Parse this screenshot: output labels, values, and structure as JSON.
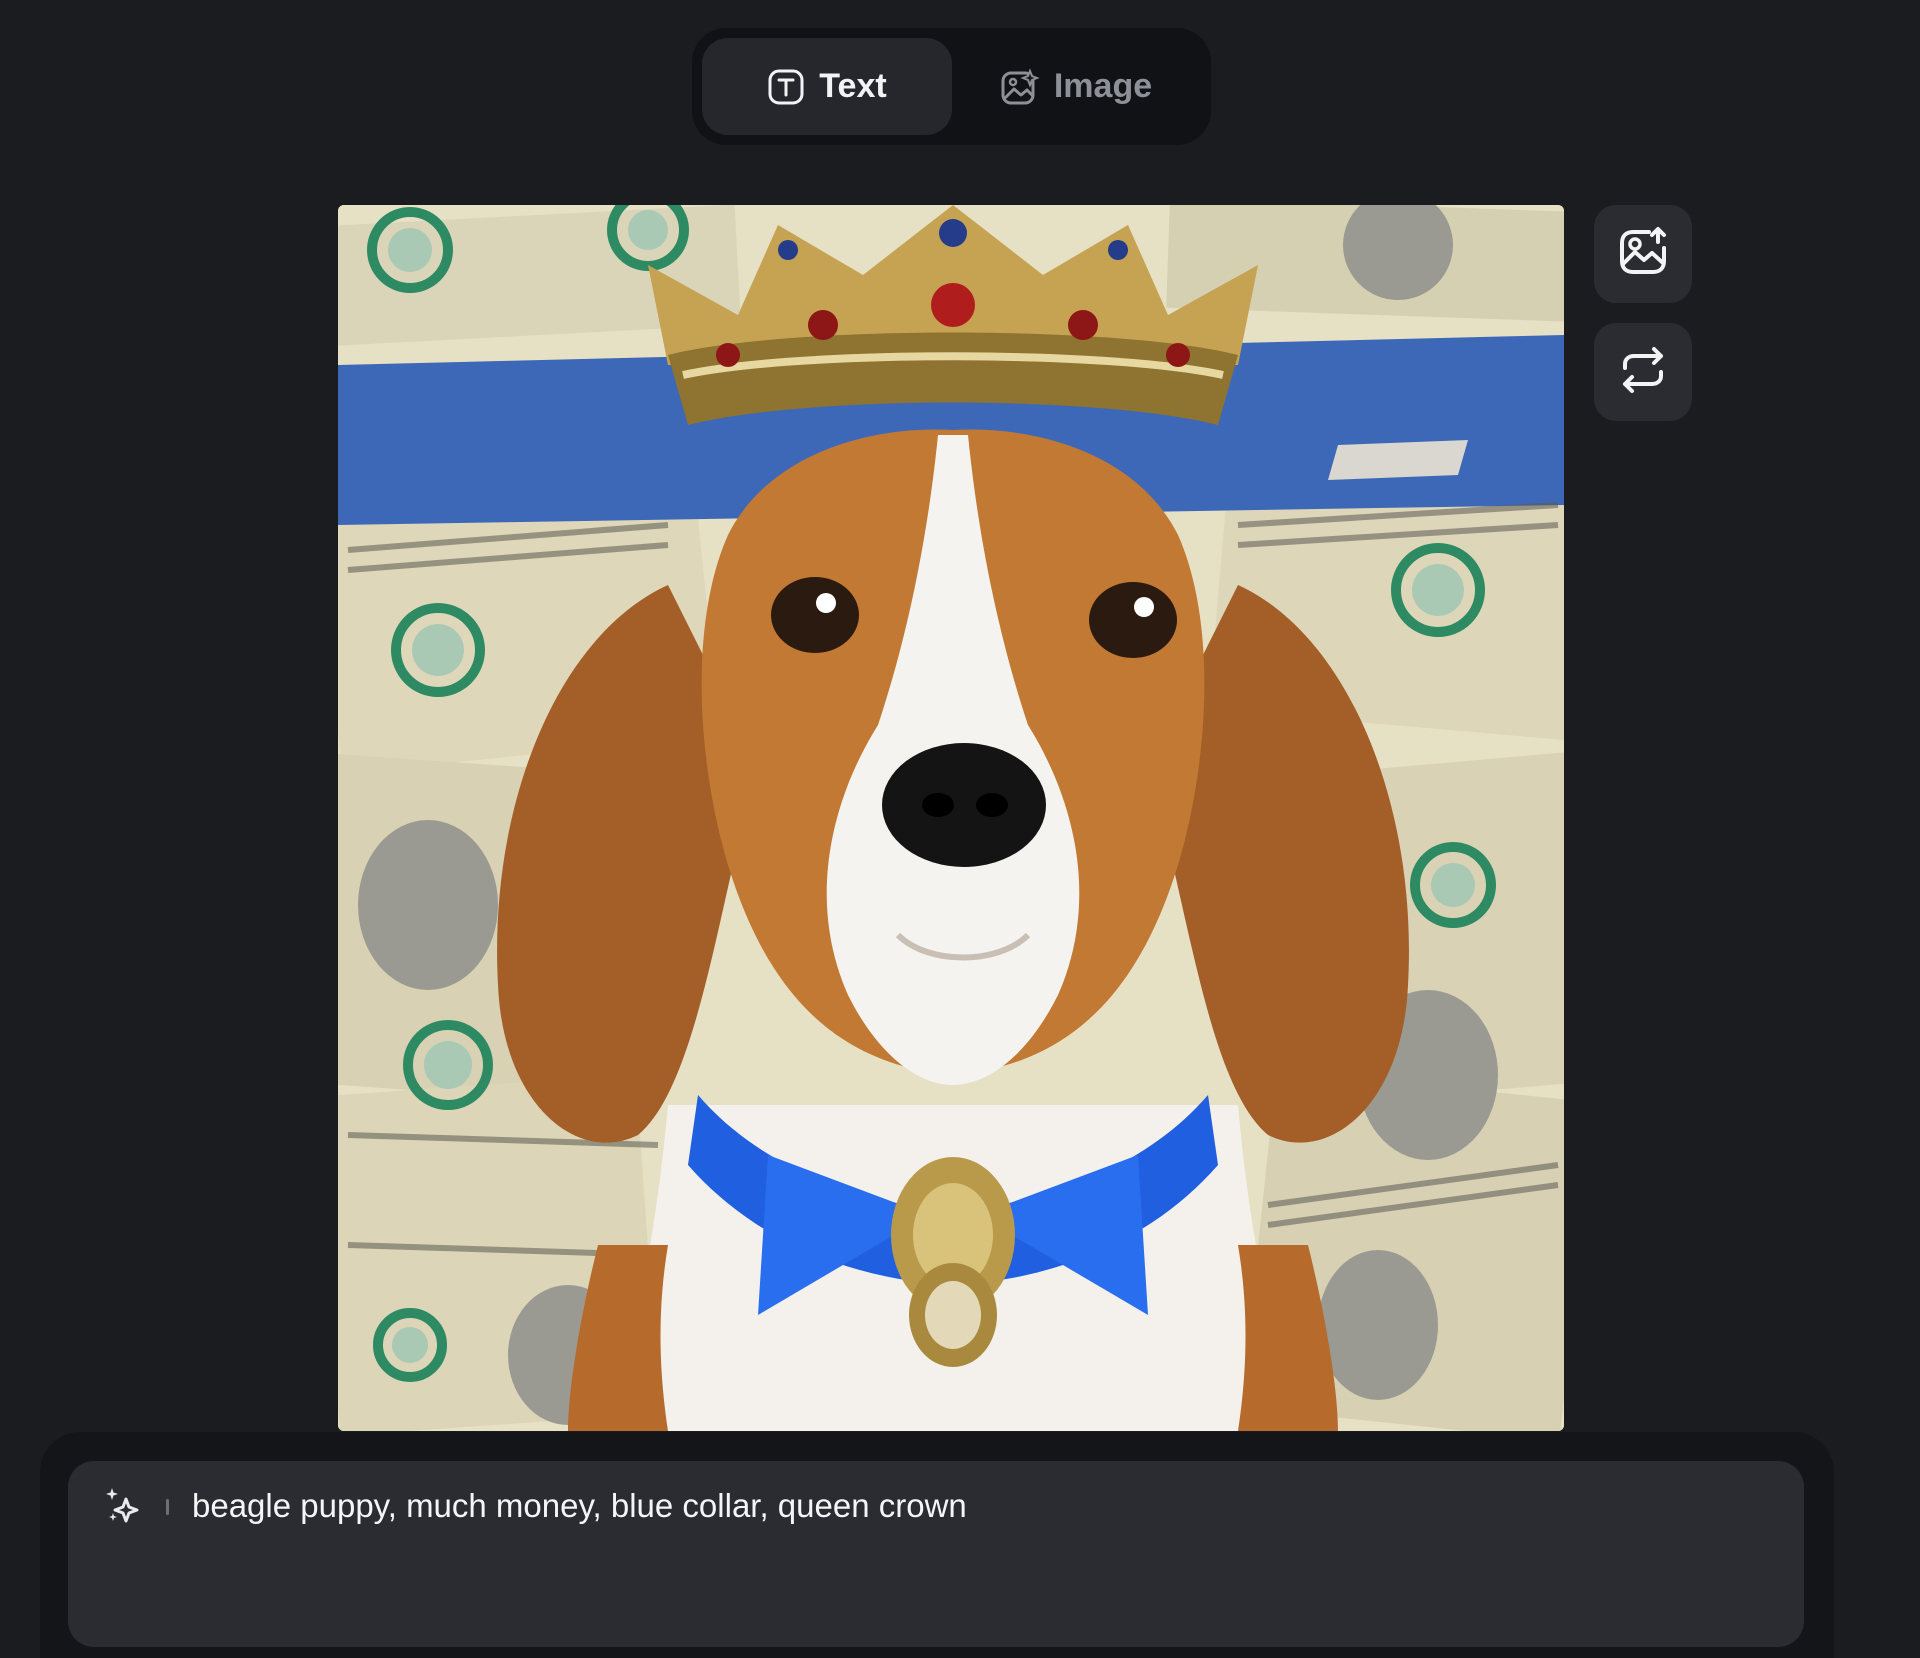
{
  "mode_toggle": {
    "tabs": [
      {
        "label": "Text",
        "icon": "text-icon",
        "active": true
      },
      {
        "label": "Image",
        "icon": "image-icon",
        "active": false
      }
    ]
  },
  "preview": {
    "icon_upload": "image-upload-icon",
    "icon_regenerate": "repeat-icon"
  },
  "prompt": {
    "icon": "sparkles-icon",
    "text": "beagle puppy, much money, blue collar, queen crown"
  },
  "colors": {
    "background": "#1b1c20",
    "active_tab": "#25272d",
    "prompt_box": "#2b2c31",
    "collar_blue": "#1f5fe0",
    "spellcheck": "#e02424"
  }
}
